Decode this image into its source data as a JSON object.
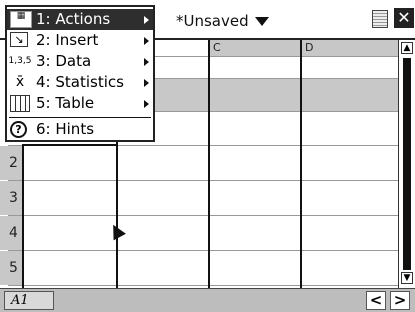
{
  "header": {
    "doc_title": "*Unsaved"
  },
  "menu": {
    "items": [
      {
        "label": "1: Actions",
        "icon": "actions-icon",
        "submenu": true,
        "selected": true
      },
      {
        "label": "2: Insert",
        "icon": "insert-icon",
        "submenu": true
      },
      {
        "label": "3: Data",
        "icon": "data-icon",
        "icon_text": "1,3,5",
        "submenu": true
      },
      {
        "label": "4: Statistics",
        "icon": "statistics-icon",
        "icon_text": "x̄",
        "submenu": true
      },
      {
        "label": "5: Table",
        "icon": "table-icon",
        "submenu": true
      },
      {
        "label": "6: Hints",
        "icon": "hints-icon",
        "icon_text": "?",
        "submenu": false
      }
    ]
  },
  "grid": {
    "columns": [
      "C",
      "D"
    ],
    "rows": [
      "2",
      "3",
      "4",
      "5"
    ]
  },
  "footer": {
    "cell_ref": "A1",
    "prev": "<",
    "next": ">"
  }
}
